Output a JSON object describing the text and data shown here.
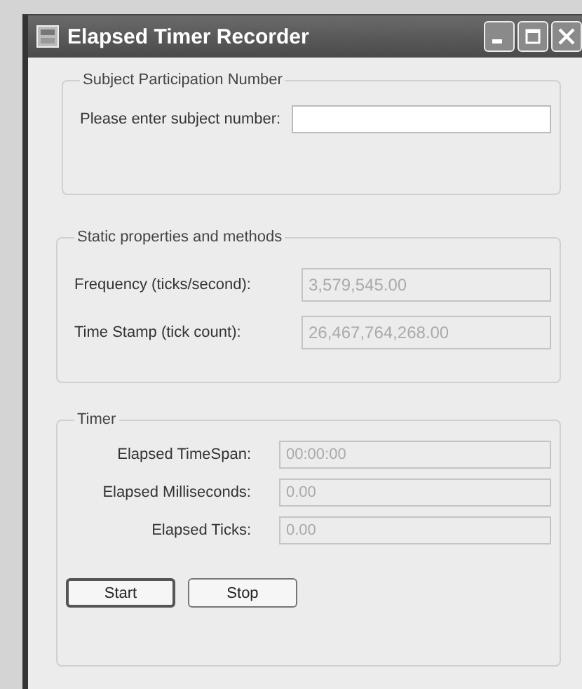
{
  "window": {
    "title": "Elapsed Timer Recorder"
  },
  "subject_group": {
    "title": "Subject Participation Number",
    "label": "Please enter subject number:",
    "disabled": false
  },
  "static_group": {
    "title": "Static properties and methods",
    "fields": [
      {
        "label": "Frequency (ticks/second):",
        "value": "3,579,545.00",
        "disabled": true
      },
      {
        "label": "Time Stamp (tick count):",
        "value": "26,467,764,268.00",
        "disabled": true
      }
    ]
  },
  "timer_group": {
    "title": "Timer",
    "fields": [
      {
        "label": "Elapsed TimeSpan:",
        "value": "00:00:00",
        "disabled": true
      },
      {
        "label": "Elapsed Milliseconds:",
        "value": "0.00",
        "disabled": true
      },
      {
        "label": "Elapsed Ticks:",
        "value": "0.00",
        "disabled": true
      }
    ],
    "buttons": [
      {
        "label": "Start",
        "focused": true
      },
      {
        "label": "Stop",
        "focused": false
      }
    ]
  }
}
